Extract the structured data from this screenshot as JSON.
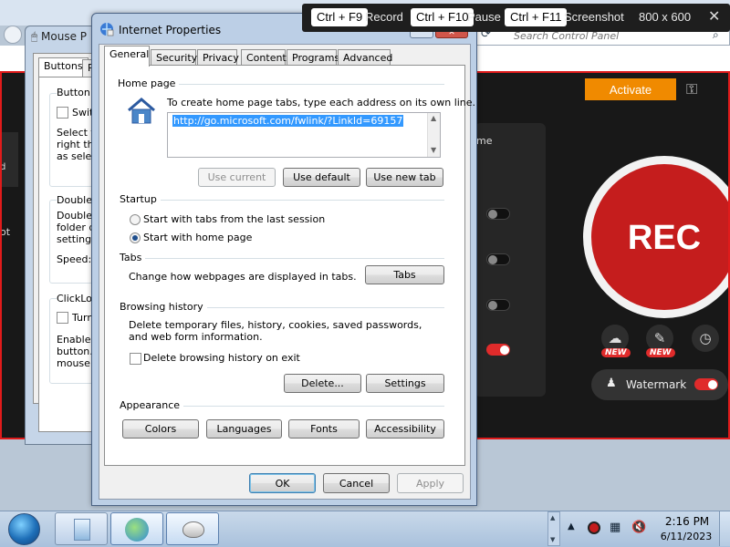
{
  "hotkeys": {
    "record_key": "Ctrl + F9",
    "record_label": "Record",
    "pause_key": "Ctrl + F10",
    "pause_label": "Pause",
    "screenshot_key": "Ctrl + F11",
    "screenshot_label": "Screenshot",
    "resolution": "800 x 600",
    "close_glyph": "✕"
  },
  "control_panel": {
    "search_placeholder": "Search Control Panel"
  },
  "recorder": {
    "activate_label": "Activate",
    "panel_label": "me",
    "left_label": "ot",
    "left_label2": "d",
    "rec_label": "REC",
    "new_badge": "NEW",
    "watermark_label": "Watermark",
    "accent_color": "#c51d1d",
    "activate_color": "#f08a00"
  },
  "mouse_window": {
    "title": "Mouse P",
    "tabs": [
      "Buttons",
      "P"
    ],
    "group1_title": "Button c",
    "group1_check": "Switc",
    "group1_text": [
      "Select th",
      "right the",
      "as selec"
    ],
    "group2_title": "Double-",
    "group2_text": [
      "Double-",
      "folder do",
      "setting."
    ],
    "speed_label": "Speed:",
    "group3_title": "ClickLoc",
    "group3_check": "Turn",
    "group3_text": [
      "Enables",
      "button.",
      "mouse b"
    ]
  },
  "ip_window": {
    "title": "Internet Properties",
    "tabs": [
      "General",
      "Security",
      "Privacy",
      "Content",
      "Programs",
      "Advanced"
    ],
    "home_page": {
      "section": "Home page",
      "description": "To create home page tabs, type each address on its own line.",
      "url": "http://go.microsoft.com/fwlink/?LinkId=69157",
      "use_current": "Use current",
      "use_default": "Use default",
      "use_new_tab": "Use new tab"
    },
    "startup": {
      "section": "Startup",
      "option_last_session": "Start with tabs from the last session",
      "option_home_page": "Start with home page"
    },
    "tabs_section": {
      "section": "Tabs",
      "description": "Change how webpages are displayed in tabs.",
      "button": "Tabs"
    },
    "browsing_history": {
      "section": "Browsing history",
      "description": "Delete temporary files, history, cookies, saved passwords, and web form information.",
      "delete_on_exit": "Delete browsing history on exit",
      "delete_button": "Delete...",
      "settings_button": "Settings"
    },
    "appearance": {
      "section": "Appearance",
      "colors": "Colors",
      "languages": "Languages",
      "fonts": "Fonts",
      "accessibility": "Accessibility"
    },
    "footer": {
      "ok": "OK",
      "cancel": "Cancel",
      "apply": "Apply"
    }
  },
  "taskbar": {
    "time": "2:16 PM",
    "date": "6/11/2023"
  }
}
